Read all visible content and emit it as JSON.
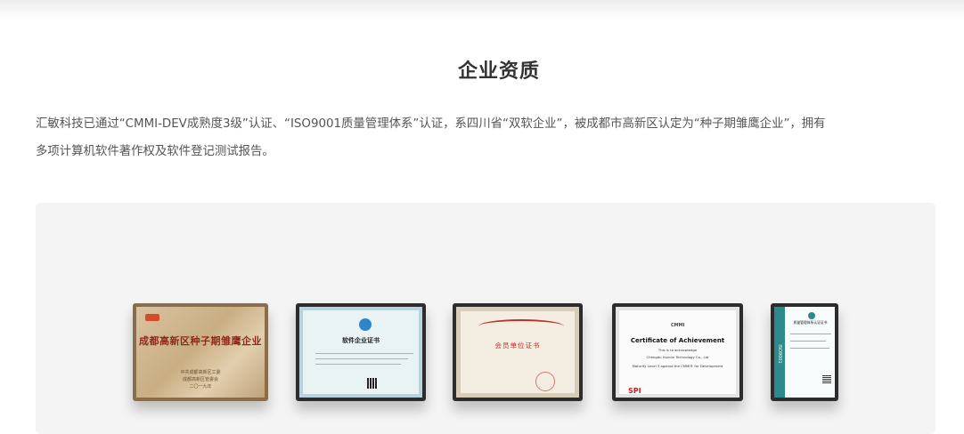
{
  "section": {
    "title": "企业资质",
    "intro_line1": "汇敏科技已通过“CMMI-DEV成熟度3级”认证、“ISO9001质量管理体系”认证，系四川省“双软企业”，被成都市高新区认定为“种子期雏鹰企业”，拥有",
    "intro_line2": "多项计算机软件著作权及软件登记测试报告。"
  },
  "certificates": [
    {
      "title": "成都高新区种子期雏鹰企业",
      "org_line1": "中共成都高新区工委",
      "org_line2": "成都高新区管委会",
      "date": "二〇一九年"
    },
    {
      "title": "软件企业证书",
      "emblem": "CSIA"
    },
    {
      "title": "会员单位证书"
    },
    {
      "cmmi": "CMMI",
      "title": "Certificate of Achievement",
      "line1": "This is to acknowledge",
      "line2": "Chengdu Huimin Technology Co., Ltd",
      "line3": "Maturity Level 3 against the CMMI® for Development",
      "logo": "SPI"
    },
    {
      "title": "质量管理体系认证证书",
      "band": "ISO9001"
    }
  ]
}
